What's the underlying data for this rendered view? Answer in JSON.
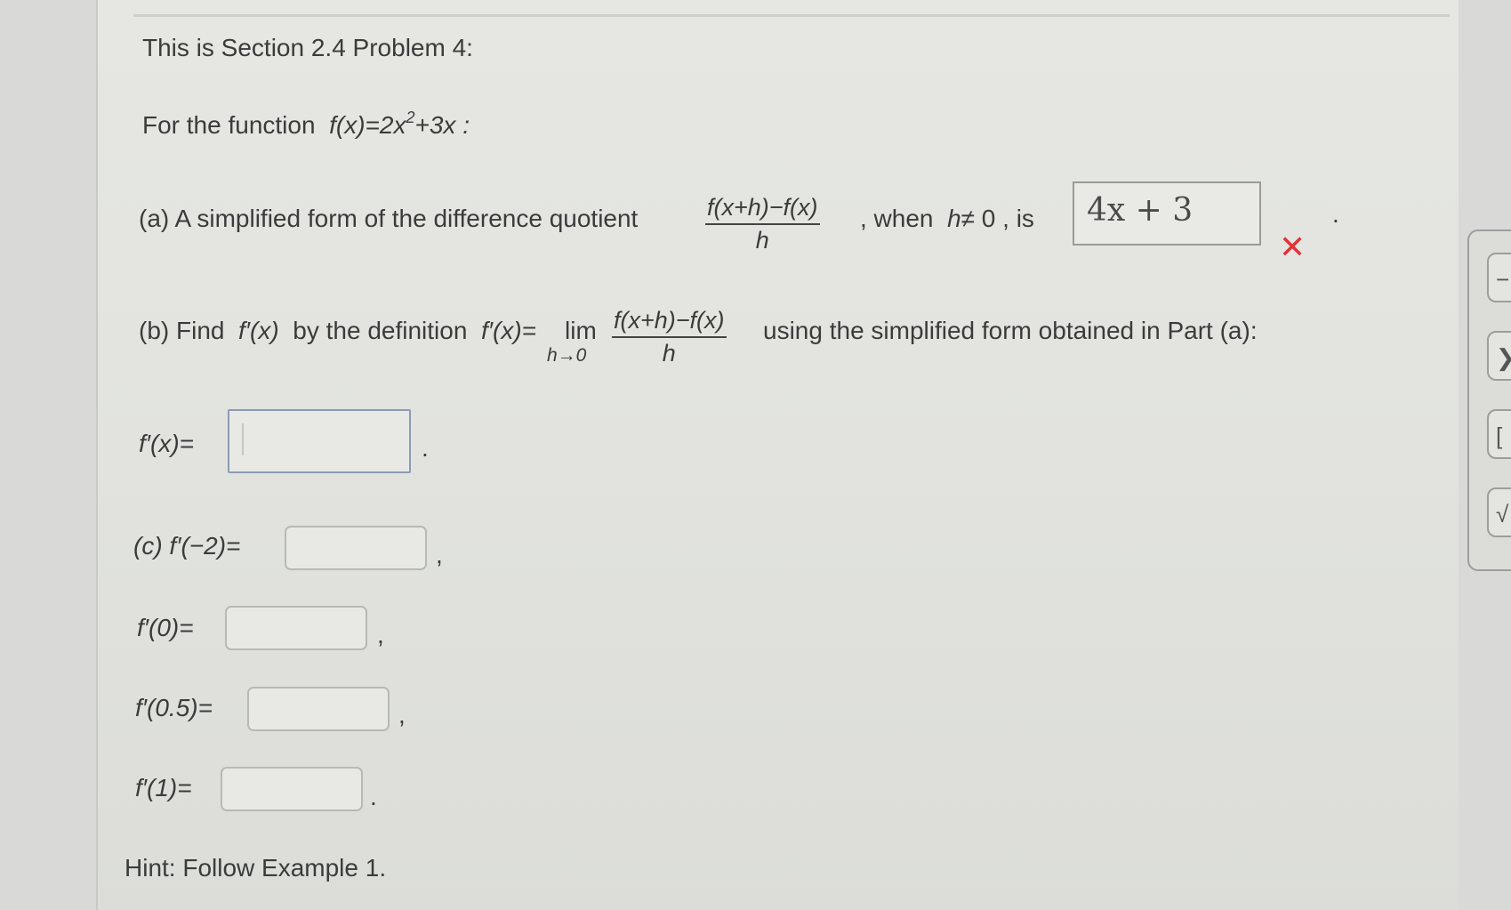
{
  "problem": {
    "heading": "This is Section 2.4 Problem 4:",
    "function_intro": "For the function",
    "function_expr_base": "f(x)=2x",
    "function_expr_exp": "2",
    "function_expr_rest": "+3x :"
  },
  "part_a": {
    "prefix": "(a) A simplified form of the difference quotient",
    "frac_num": "f(x+h)−f(x)",
    "frac_den": "h",
    "when_text": ", when",
    "cond_var": "h",
    "cond_rest": "≠ 0 , is",
    "answer_value": "4x + 3",
    "period": ".",
    "status_icon": "wrong-x-icon",
    "status_color": "#e2323a"
  },
  "part_b": {
    "prefix": "(b) Find",
    "fprime": "f′(x)",
    "by_def": "by the definition",
    "fprime_eq": "f′(x)=",
    "lim": "lim",
    "lim_sub": "h→0",
    "frac_num": "f(x+h)−f(x)",
    "frac_den": "h",
    "suffix": "using the simplified form obtained in Part (a):",
    "answer_label": "f′(x)=",
    "answer_value": "",
    "period": "."
  },
  "part_c": {
    "label_m2": "(c)  f′(−2)=",
    "label_0": "f′(0)=",
    "label_05": "f′(0.5)=",
    "label_1": "f′(1)=",
    "comma": ",",
    "period": ".",
    "value_m2": "",
    "value_0": "",
    "value_05": "",
    "value_1": ""
  },
  "hint": "Hint: Follow Example 1.",
  "side_toolbar": {
    "btn1": "−",
    "btn2": "❯",
    "btn3": "[",
    "btn4": "√"
  }
}
